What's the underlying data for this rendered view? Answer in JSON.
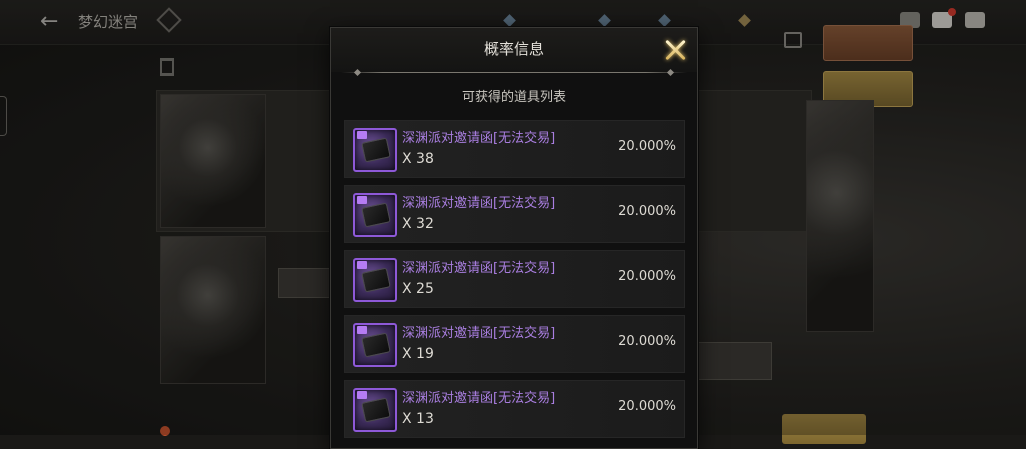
{
  "header": {
    "page_title": "梦幻迷宫"
  },
  "modal": {
    "title": "概率信息",
    "subtitle": "可获得的道具列表",
    "items": [
      {
        "name": "深渊派对邀请函[无法交易]",
        "quantity": "X 38",
        "probability": "20.000%"
      },
      {
        "name": "深渊派对邀请函[无法交易]",
        "quantity": "X 32",
        "probability": "20.000%"
      },
      {
        "name": "深渊派对邀请函[无法交易]",
        "quantity": "X 25",
        "probability": "20.000%"
      },
      {
        "name": "深渊派对邀请函[无法交易]",
        "quantity": "X 19",
        "probability": "20.000%"
      },
      {
        "name": "深渊派对邀请函[无法交易]",
        "quantity": "X 13",
        "probability": "20.000%"
      }
    ]
  },
  "colors": {
    "item_name": "#a97ee0",
    "item_border": "#8e59d8",
    "close_icon": "#e8c66a"
  },
  "icons": {
    "back": "back-arrow-icon",
    "close": "close-icon",
    "item": "invitation-item-icon"
  }
}
